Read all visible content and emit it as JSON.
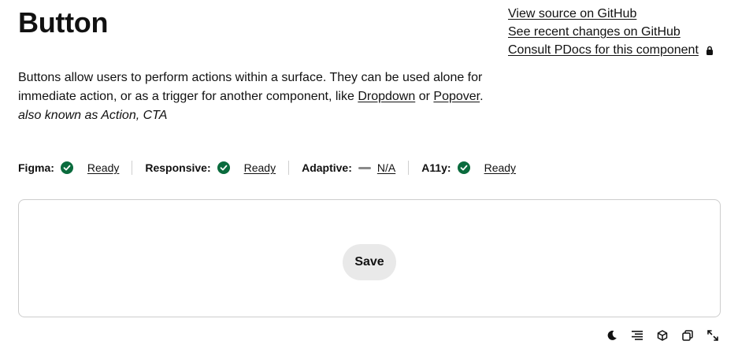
{
  "page": {
    "title": "Button",
    "description_part1": "Buttons allow users to perform actions within a surface. They can be used alone for immediate action, or as a trigger for another component, like ",
    "link_dropdown": "Dropdown",
    "description_or": " or ",
    "link_popover": "Popover",
    "description_end": ".",
    "aka": "also known as Action, CTA"
  },
  "links": {
    "github_source": "View source on GitHub",
    "github_changes": "See recent changes on GitHub",
    "pdocs": "Consult PDocs for this component"
  },
  "status": [
    {
      "label": "Figma:",
      "value": "Ready",
      "icon": "check-circle-icon"
    },
    {
      "label": "Responsive:",
      "value": "Ready",
      "icon": "check-circle-icon"
    },
    {
      "label": "Adaptive:",
      "value": "N/A",
      "icon": "dash-icon"
    },
    {
      "label": "A11y:",
      "value": "Ready",
      "icon": "check-circle-icon"
    }
  ],
  "colors": {
    "ready": "#0a6b3d",
    "na": "#8a8a8a",
    "button_bg": "#e9e9e9"
  },
  "demo": {
    "save_label": "Save"
  },
  "toolbar": {
    "icons": [
      "moon-icon",
      "align-right-icon",
      "cube-icon",
      "copy-icon",
      "expand-icon"
    ]
  }
}
